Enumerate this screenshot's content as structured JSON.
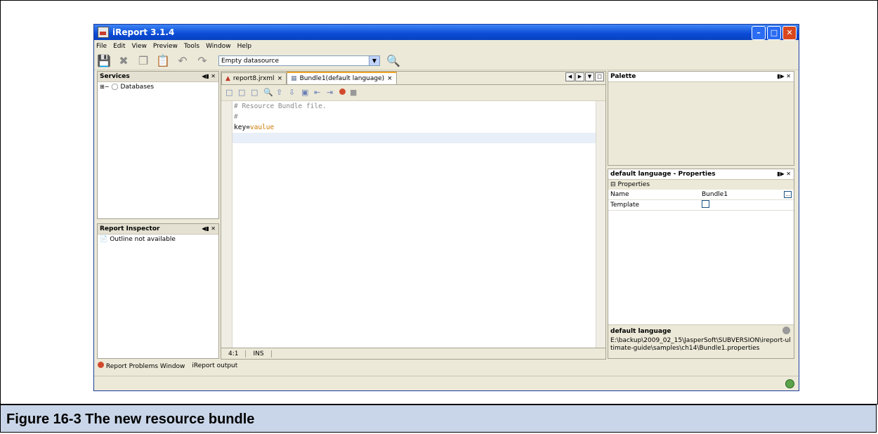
{
  "window": {
    "title": "iReport 3.1.4"
  },
  "menu": [
    "File",
    "Edit",
    "View",
    "Preview",
    "Tools",
    "Window",
    "Help"
  ],
  "toolbar": {
    "datasource": "Empty datasource"
  },
  "services": {
    "title": "Services",
    "items": [
      "Databases"
    ]
  },
  "report_inspector": {
    "title": "Report Inspector",
    "message": "Outline not available"
  },
  "editor": {
    "tabs": [
      {
        "label": "report8.jrxml",
        "active": false
      },
      {
        "label": "Bundle1(default language)",
        "active": true
      }
    ],
    "lines": {
      "l1": "# Resource Bundle file.",
      "l2": "#",
      "l3_key": "key=",
      "l3_val": "vaulue"
    },
    "cursor": "4:1",
    "mode": "INS"
  },
  "palette": {
    "title": "Palette"
  },
  "properties": {
    "title": "default language - Properties",
    "section": "Properties",
    "rows": [
      {
        "name": "Name",
        "value": "Bundle1"
      },
      {
        "name": "Template",
        "value": ""
      }
    ],
    "desc_title": "default language",
    "desc_text": "E:\\backup\\2009_02_15\\JasperSoft\\SUBVERSION\\ireport-ultimate-guide\\samples\\ch14\\Bundle1.properties"
  },
  "bottom": {
    "problems": "Report Problems Window",
    "output": "iReport output"
  },
  "caption": "Figure 16-3    The new resource bundle"
}
